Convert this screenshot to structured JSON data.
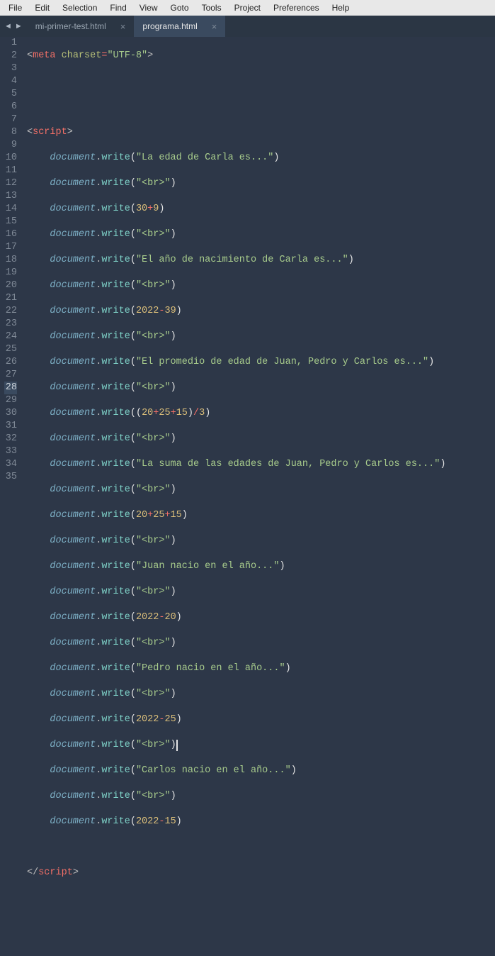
{
  "menu": {
    "file": "File",
    "edit": "Edit",
    "selection": "Selection",
    "find": "Find",
    "view": "View",
    "goto": "Goto",
    "tools": "Tools",
    "project": "Project",
    "preferences": "Preferences",
    "help": "Help"
  },
  "nav": {
    "back": "◄",
    "forward": "►"
  },
  "tabs": {
    "t0": {
      "label": "mi-primer-test.html",
      "close": "×"
    },
    "t1": {
      "label": "programa.html",
      "close": "×"
    }
  },
  "lines": {
    "l1": "1",
    "l2": "2",
    "l3": "3",
    "l4": "4",
    "l5": "5",
    "l6": "6",
    "l7": "7",
    "l8": "8",
    "l9": "9",
    "l10": "10",
    "l11": "11",
    "l12": "12",
    "l13": "13",
    "l14": "14",
    "l15": "15",
    "l16": "16",
    "l17": "17",
    "l18": "18",
    "l19": "19",
    "l20": "20",
    "l21": "21",
    "l22": "22",
    "l23": "23",
    "l24": "24",
    "l25": "25",
    "l26": "26",
    "l27": "27",
    "l28": "28",
    "l29": "29",
    "l30": "30",
    "l31": "31",
    "l32": "32",
    "l33": "33",
    "l34": "34",
    "l35": "35"
  },
  "tok": {
    "lt": "<",
    "gt": ">",
    "lts": "</",
    "meta": "meta",
    "script": "script",
    "charset": "charset",
    "eq": "=",
    "utf": "\"UTF-8\"",
    "doc": "document",
    "dot": ".",
    "write": "write",
    "op": "(",
    "cp": ")",
    "s1": "\"La edad de Carla es...\"",
    "br": "\"<br>\"",
    "n30": "30",
    "plus": "+",
    "n9": "9",
    "s2": "\"El año de nacimiento de Carla es...\"",
    "n2022": "2022",
    "minus": "-",
    "n39": "39",
    "s3": "\"El promedio de edad de Juan, Pedro y Carlos es...\"",
    "n20": "20",
    "n25": "25",
    "n15": "15",
    "op2": "(",
    "cp2": ")",
    "slash": "/",
    "n3": "3",
    "s4": "\"La suma de las edades de Juan, Pedro y Carlos es...\"",
    "s5": "\"Juan nacio en el año...\"",
    "s6": "\"Pedro nacio en el año...\"",
    "s7": "\"Carlos nacio en el año...\""
  }
}
